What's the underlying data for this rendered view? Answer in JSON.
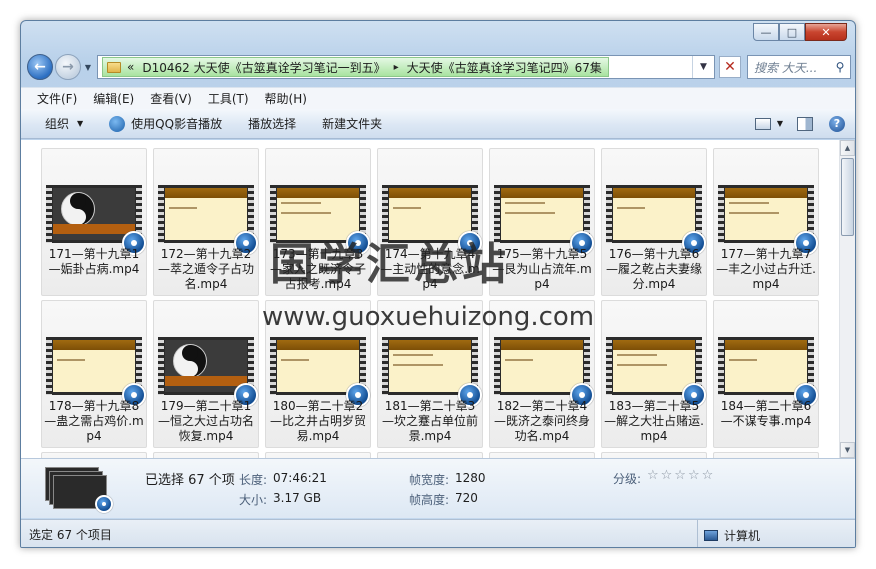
{
  "window": {
    "caption_min": "—",
    "caption_max": "□",
    "caption_close": "✕"
  },
  "address_bar": {
    "chevrons": "«",
    "crumb1": "D10462 大天使《古筮真诠学习笔记一到五》",
    "separator": "▸",
    "crumb2": "大天使《古筮真诠学习笔记四》67集",
    "search_placeholder": "搜索 大天..."
  },
  "menu": [
    "文件(F)",
    "编辑(E)",
    "查看(V)",
    "工具(T)",
    "帮助(H)"
  ],
  "commands": {
    "organize": "组织",
    "play_qq": "使用QQ影音播放",
    "play_selection": "播放选择",
    "new_folder": "新建文件夹"
  },
  "files": [
    {
      "name": "171—第十九章1—姤卦占病.mp4",
      "thumb": "yinyang"
    },
    {
      "name": "172—第十九章2—萃之遁令子占功名.mp4",
      "thumb": "slide"
    },
    {
      "name": "173—第十九章3—家人之既济令子占报考.mp4",
      "thumb": "slide"
    },
    {
      "name": "174—第十九章4—主动性的意念.mp4",
      "thumb": "slide"
    },
    {
      "name": "175—第十九章5—艮为山占流年.mp4",
      "thumb": "slide"
    },
    {
      "name": "176—第十九章6—履之乾占夫妻缘分.mp4",
      "thumb": "slide"
    },
    {
      "name": "177—第十九章7—丰之小过占升迁.mp4",
      "thumb": "slide"
    },
    {
      "name": "178—第十九章8—蛊之需占鸡价.mp4",
      "thumb": "slide"
    },
    {
      "name": "179—第二十章1—恒之大过占功名恢复.mp4",
      "thumb": "yinyang"
    },
    {
      "name": "180—第二十章2—比之井占明岁贸易.mp4",
      "thumb": "slide"
    },
    {
      "name": "181—第二十章3—坎之蹇占单位前景.mp4",
      "thumb": "slide"
    },
    {
      "name": "182—第二十章4—既济之泰问终身功名.mp4",
      "thumb": "slide"
    },
    {
      "name": "183—第二十章5—解之大壮占赌运.mp4",
      "thumb": "slide"
    },
    {
      "name": "184—第二十章6—不谋专事.mp4",
      "thumb": "slide"
    }
  ],
  "details": {
    "selected": "已选择 67 个项",
    "length_label": "长度:",
    "length_value": "07:46:21",
    "size_label": "大小:",
    "size_value": "3.17 GB",
    "frame_width_label": "帧宽度:",
    "frame_width_value": "1280",
    "frame_height_label": "帧高度:",
    "frame_height_value": "720",
    "rating_label": "分级:",
    "rating_stars": "☆☆☆☆☆"
  },
  "status": {
    "left": "选定 67 个项目",
    "right": "计算机"
  },
  "watermark": {
    "line1": "国学汇总站",
    "line2": "www.guoxuehuizong.com"
  }
}
